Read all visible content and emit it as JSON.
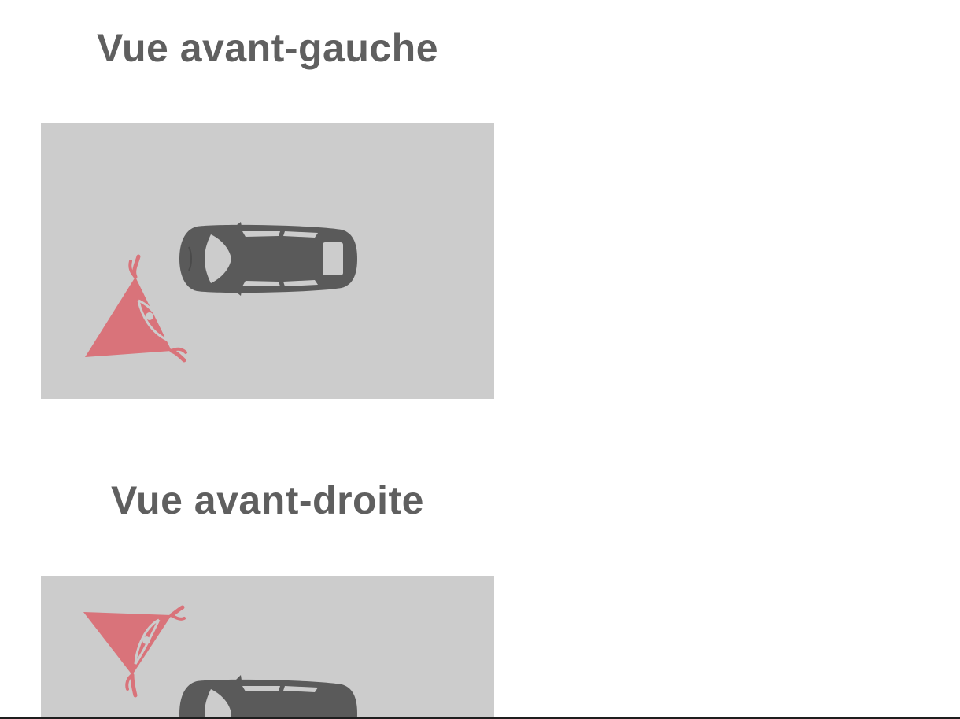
{
  "colors": {
    "background": "#ffffff",
    "card_background": "#cccccc",
    "title_text": "#5f5f5f",
    "car": "#5a5a5a",
    "car_windows": "#cccccc",
    "viewpoint": "#d9737a"
  },
  "views": [
    {
      "title": "Vue avant-gauche",
      "icons": [
        "car-top-view-icon",
        "eye-viewpoint-icon"
      ]
    },
    {
      "title": "Vue avant-droite",
      "icons": [
        "car-top-view-icon",
        "eye-viewpoint-icon"
      ]
    }
  ]
}
